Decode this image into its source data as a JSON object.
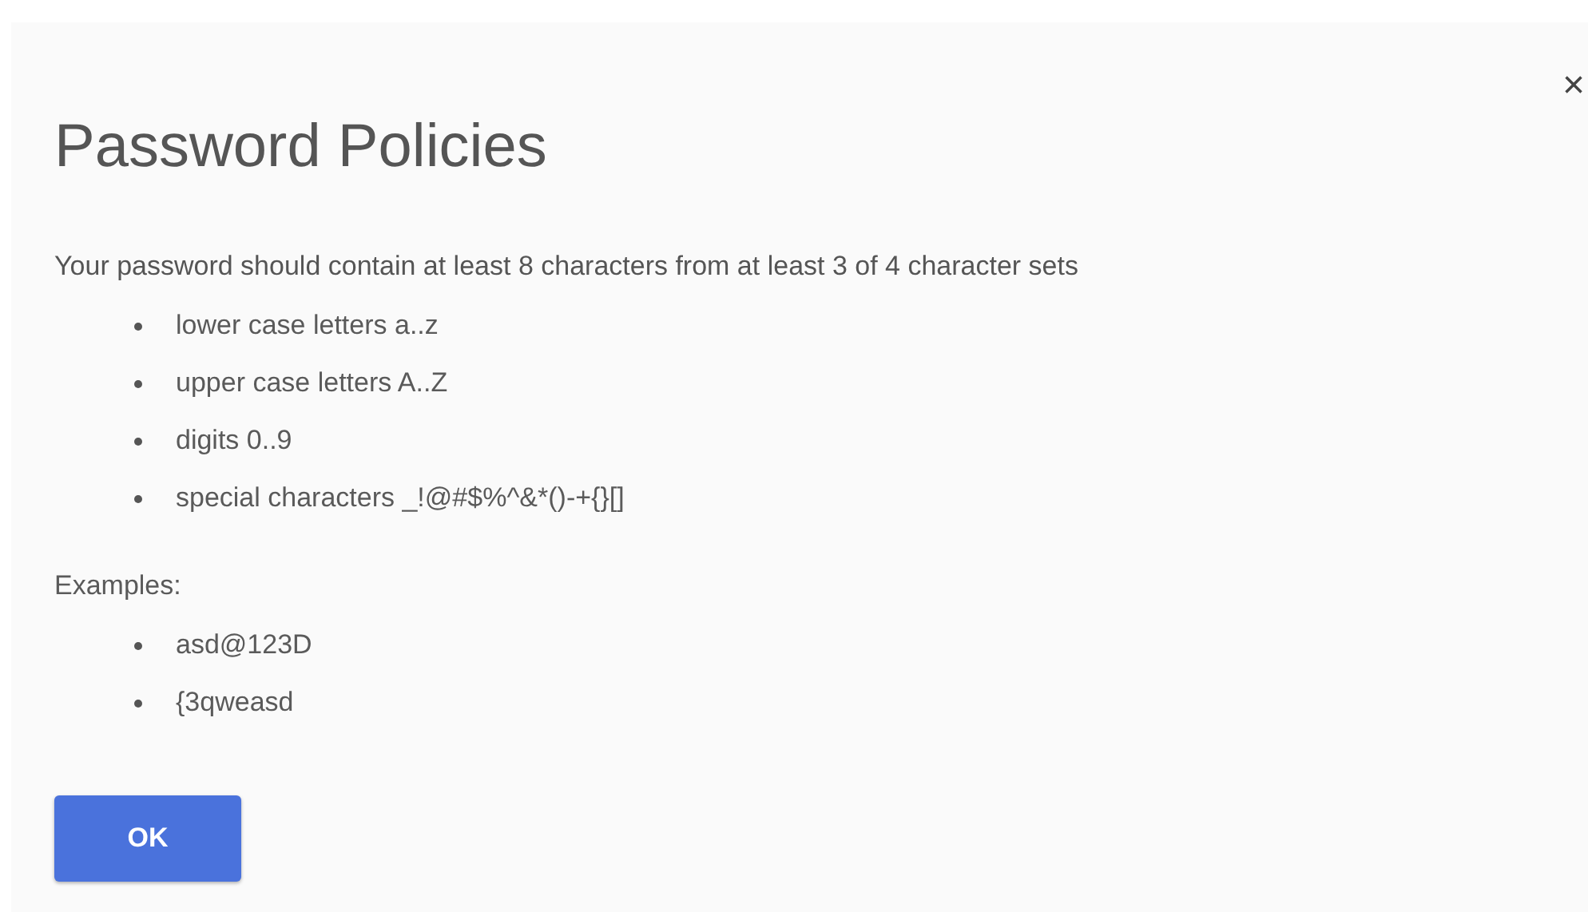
{
  "dialog": {
    "close": "×",
    "title": "Password Policies",
    "intro": "Your password should contain at least 8 characters from at least 3 of 4 character sets",
    "rules": [
      "lower case letters a..z",
      "upper case letters A..Z",
      "digits 0..9",
      "special characters _!@#$%^&*()-+{}[]"
    ],
    "examples_label": "Examples:",
    "examples": [
      "asd@123D",
      "{3qweasd"
    ],
    "buttons": [
      "OK"
    ]
  }
}
